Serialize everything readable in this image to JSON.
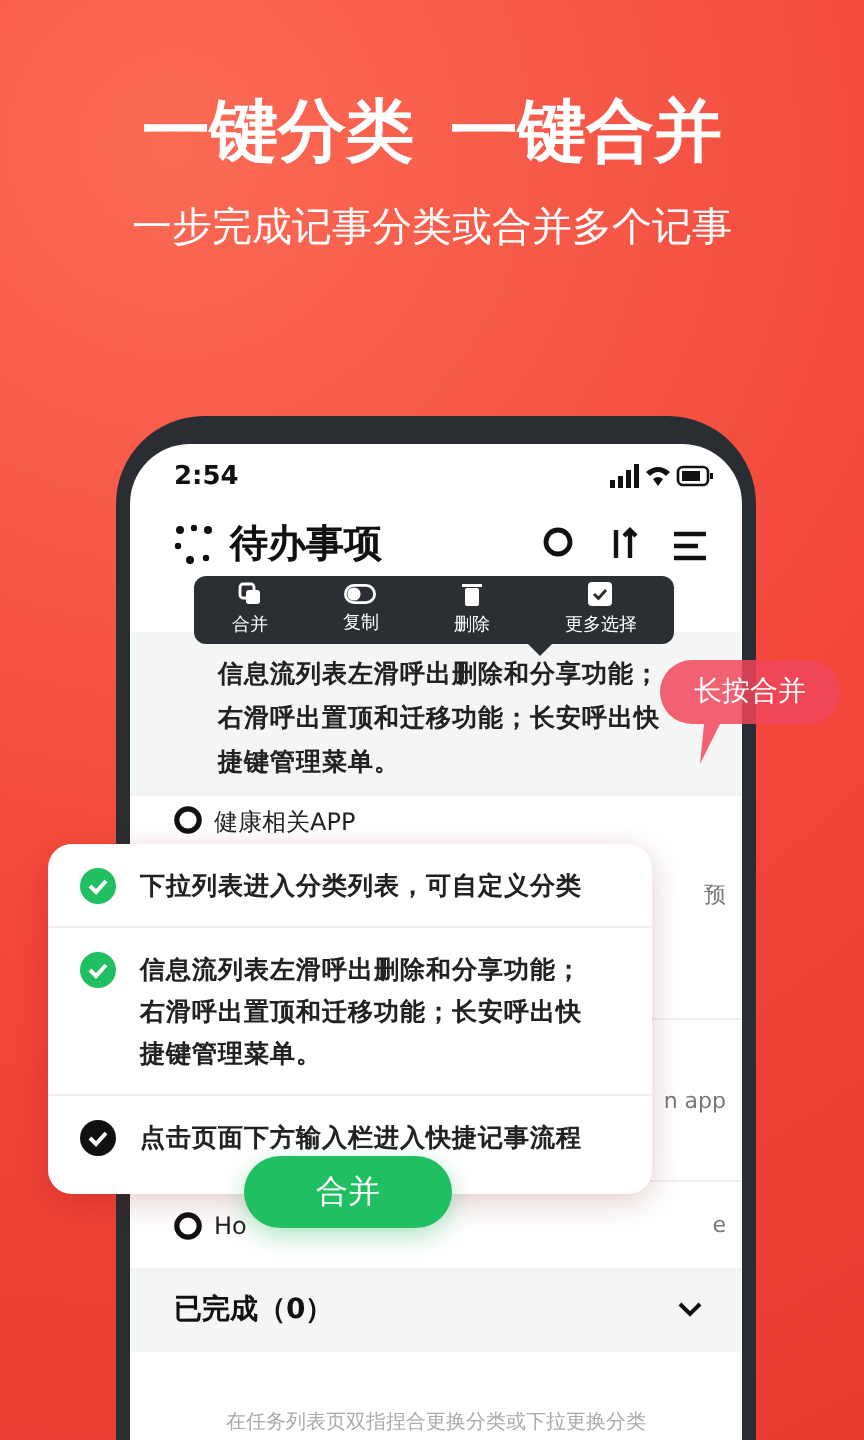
{
  "headline": [
    "一键分类",
    "一键合并"
  ],
  "subtitle": "一步完成记事分类或合并多个记事",
  "phone": {
    "status_time": "2:54",
    "title": "待办事项",
    "menu_actions": [
      {
        "kind": "merge",
        "label": "合并"
      },
      {
        "kind": "copy",
        "label": "复制"
      },
      {
        "kind": "delete",
        "label": "删除"
      },
      {
        "kind": "select",
        "label": "更多选择"
      }
    ],
    "selected_note": "信息流列表左滑呼出删除和分享功能；右滑呼出置顶和迁移功能；长安呼出快捷键管理菜单。",
    "tasks": [
      {
        "text": "健康相关APP",
        "checked": false
      },
      {
        "side": "预"
      },
      {
        "side": "n app"
      },
      {
        "text": "Ho",
        "side": "e",
        "checked": false
      }
    ],
    "completed": {
      "label": "已完成（0）"
    },
    "hint": "在任务列表页双指捏合更换分类或下拉更换分类"
  },
  "bubble": "长按合并",
  "feature_card": [
    {
      "text": "下拉列表进入分类列表，可自定义分类",
      "color": "#1fbf62"
    },
    {
      "text": "信息流列表左滑呼出删除和分享功能；右滑呼出置顶和迁移功能；长安呼出快捷键管理菜单。",
      "color": "#1fbf62"
    },
    {
      "text": "点击页面下方输入栏进入快捷记事流程",
      "color": "#111111"
    }
  ],
  "merge_button": "合并"
}
